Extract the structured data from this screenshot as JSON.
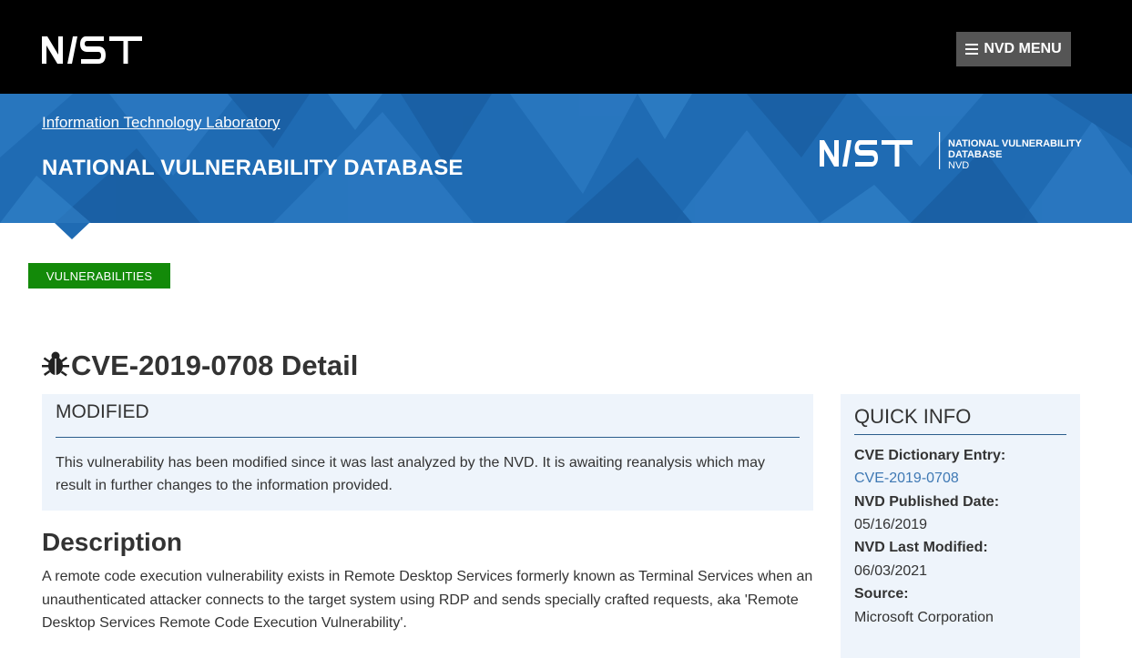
{
  "header": {
    "logo_text": "NIST",
    "menu_label": "NVD MENU"
  },
  "banner": {
    "lab_link": "Information Technology Laboratory",
    "title": "NATIONAL VULNERABILITY DATABASE",
    "logo_line1": "NATIONAL VULNERABILITY",
    "logo_line2": "DATABASE",
    "logo_line3": "NVD"
  },
  "badge": {
    "label": "VULNERABILITIES"
  },
  "page": {
    "title": "CVE-2019-0708 Detail",
    "icon": "bug-icon"
  },
  "modified": {
    "title": "MODIFIED",
    "text": "This vulnerability has been modified since it was last analyzed by the NVD. It is awaiting reanalysis which may result in further changes to the information provided."
  },
  "description": {
    "heading": "Description",
    "text": "A remote code execution vulnerability exists in Remote Desktop Services formerly known as Terminal Services when an unauthenticated attacker connects to the target system using RDP and sends specially crafted requests, aka 'Remote Desktop Services Remote Code Execution Vulnerability'."
  },
  "quick_info": {
    "title": "QUICK INFO",
    "cve_label": "CVE Dictionary Entry:",
    "cve_value": "CVE-2019-0708",
    "published_label": "NVD Published Date:",
    "published_value": "05/16/2019",
    "modified_label": "NVD Last Modified:",
    "modified_value": "06/03/2021",
    "source_label": "Source:",
    "source_value": "Microsoft Corporation"
  },
  "colors": {
    "banner_blue": "#1f6bb3",
    "badge_green": "#138a09",
    "panel_bg": "#eef4fb",
    "link_blue": "#3f79b4"
  }
}
